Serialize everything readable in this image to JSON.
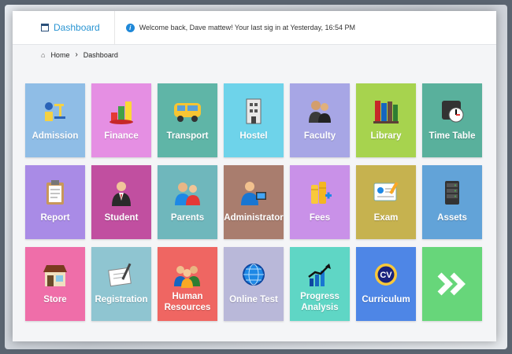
{
  "header": {
    "tab_label": "Dashboard",
    "welcome": "Welcome back,  Dave mattew!  Your last sig in at Yesterday, 16:54 PM"
  },
  "breadcrumb": {
    "home": "Home",
    "separator": "›",
    "current": "Dashboard"
  },
  "tiles": [
    {
      "label": "Admission",
      "color": "#8fbde6",
      "icon": "admission-icon"
    },
    {
      "label": "Finance",
      "color": "#e58fe3",
      "icon": "finance-chart-icon"
    },
    {
      "label": "Transport",
      "color": "#5fb5a7",
      "icon": "bus-icon"
    },
    {
      "label": "Hostel",
      "color": "#6ed3ea",
      "icon": "building-icon"
    },
    {
      "label": "Faculty",
      "color": "#a7a6e5",
      "icon": "people-icon"
    },
    {
      "label": "Library",
      "color": "#a7d34e",
      "icon": "books-icon"
    },
    {
      "label": "Time Table",
      "color": "#59b09c",
      "icon": "clock-icon"
    },
    {
      "label": "Report",
      "color": "#a98be6",
      "icon": "clipboard-icon"
    },
    {
      "label": "Student",
      "color": "#c14fa0",
      "icon": "student-icon"
    },
    {
      "label": "Parents",
      "color": "#6fb7bc",
      "icon": "parents-icon"
    },
    {
      "label": "Administrator",
      "color": "#a97d6e",
      "icon": "administrator-icon"
    },
    {
      "label": "Fees",
      "color": "#c991e8",
      "icon": "coins-icon"
    },
    {
      "label": "Exam",
      "color": "#c6b24f",
      "icon": "exam-certificate-icon"
    },
    {
      "label": "Assets",
      "color": "#62a3d8",
      "icon": "server-icon"
    },
    {
      "label": "Store",
      "color": "#ef6ea9",
      "icon": "store-icon"
    },
    {
      "label": "Registration",
      "color": "#8fc5d1",
      "icon": "registration-pen-icon"
    },
    {
      "label": "Human\nResources",
      "color": "#ef6662",
      "icon": "team-icon"
    },
    {
      "label": "Online Test",
      "color": "#b9b8d9",
      "icon": "globe-icon"
    },
    {
      "label": "Progress\nAnalysis",
      "color": "#5fd6c5",
      "icon": "growth-chart-icon"
    },
    {
      "label": "Curriculum",
      "color": "#4e86e6",
      "icon": "cv-icon"
    },
    {
      "label": "",
      "color": "#67d67a",
      "icon": "double-chevron-right-icon"
    }
  ]
}
